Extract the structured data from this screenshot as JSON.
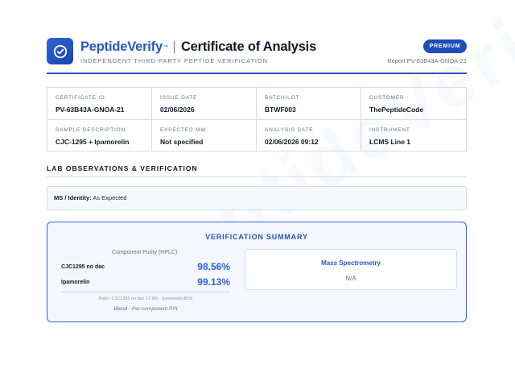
{
  "watermark": "PeptideVerify",
  "header": {
    "brand": "PeptideVerify",
    "trademark": "™",
    "title": "Certificate of Analysis",
    "tagline": "INDEPENDENT THIRD-PARTY PEPTIDE VERIFICATION",
    "badge": "PREMIUM",
    "report_id": "Report PV-63B43A-GNOA-21",
    "logo_icon": "verify-check-icon"
  },
  "info": [
    {
      "label": "CERTIFICATE ID",
      "value": "PV-63B43A-GNOA-21"
    },
    {
      "label": "ISSUE DATE",
      "value": "02/06/2026"
    },
    {
      "label": "BATCH/LOT",
      "value": "BTWF003"
    },
    {
      "label": "CUSTOMER",
      "value": "ThePeptideCode"
    },
    {
      "label": "SAMPLE DESCRIPTION",
      "value": "CJC-1295 + Ipamorelin"
    },
    {
      "label": "EXPECTED MW",
      "value": "Not specified"
    },
    {
      "label": "ANALYSIS DATE",
      "value": "02/06/2026 09:12"
    },
    {
      "label": "INSTRUMENT",
      "value": "LCMS Line 1"
    }
  ],
  "observations": {
    "section_title": "LAB OBSERVATIONS & VERIFICATION",
    "label": "MS / Identity:",
    "value": "As Expected"
  },
  "summary": {
    "title": "VERIFICATION SUMMARY",
    "component_title": "Component Purity (HPLC)",
    "components": [
      {
        "name": "CJC1295 no dac",
        "purity": "98.56%"
      },
      {
        "name": "Ipamorelin",
        "purity": "99.13%"
      }
    ],
    "ratio": "Ratio: CJC1295 no dac 17.9% : Ipamorelin 81%",
    "blend_note": "Blend - Per-component PPI",
    "ms_title": "Mass Spectrometry",
    "ms_value": "N/A"
  },
  "colors": {
    "accent": "#2557c4",
    "badge": "#1f4db8",
    "summary_border": "#2f63d6"
  }
}
